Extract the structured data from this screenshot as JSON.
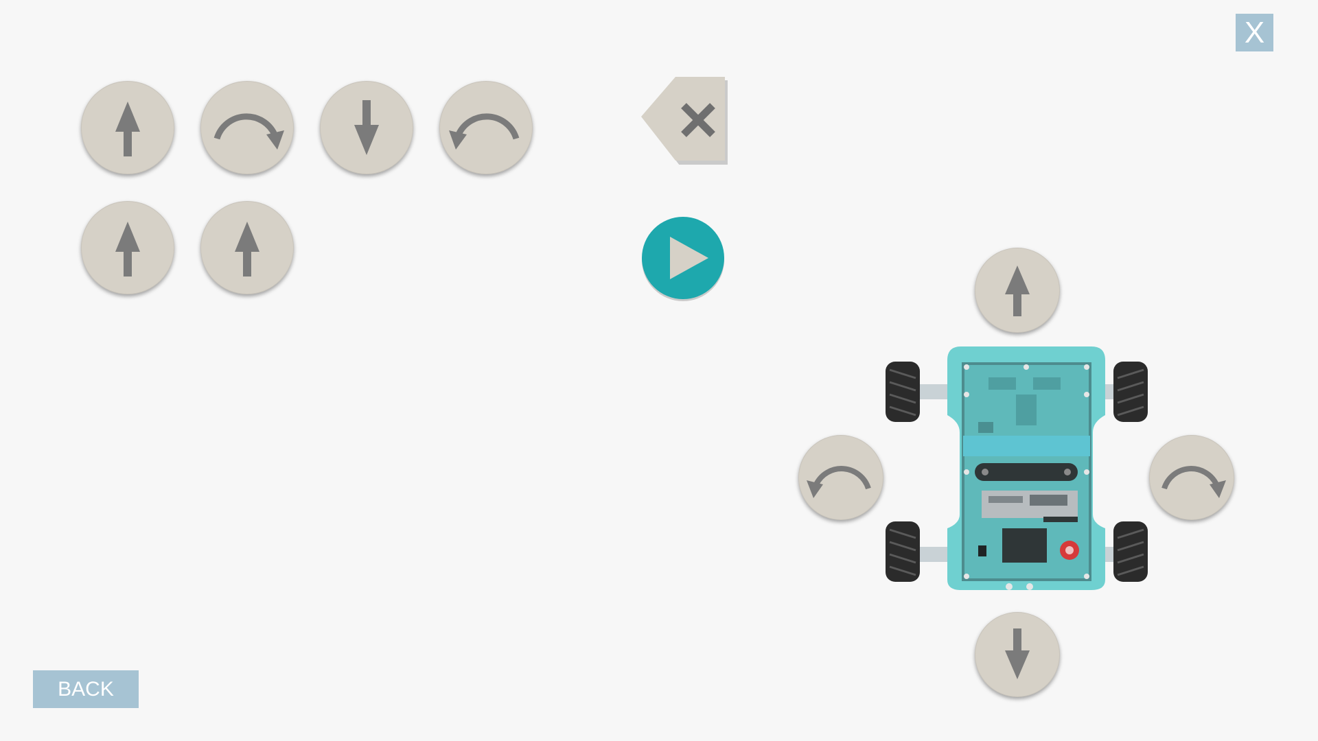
{
  "window": {
    "close_label": "X"
  },
  "footer": {
    "back_label": "BACK"
  },
  "program": {
    "commands": [
      {
        "action": "forward",
        "icon": "arrow-up-icon"
      },
      {
        "action": "turn-right",
        "icon": "rotate-right-icon"
      },
      {
        "action": "backward",
        "icon": "arrow-down-icon"
      },
      {
        "action": "turn-left",
        "icon": "rotate-left-icon"
      },
      {
        "action": "forward",
        "icon": "arrow-up-icon"
      },
      {
        "action": "forward",
        "icon": "arrow-up-icon"
      }
    ]
  },
  "controls": {
    "forward_icon": "arrow-up-icon",
    "backward_icon": "arrow-down-icon",
    "turn_left_icon": "rotate-left-icon",
    "turn_right_icon": "rotate-right-icon",
    "delete_icon": "backspace-icon",
    "run_icon": "play-icon"
  },
  "colors": {
    "button_face": "#d6d1c7",
    "icon": "#7b7b7b",
    "accent_play": "#1ea8ad",
    "action_button": "#a6c3d3",
    "robot_body": "#6fd0d0",
    "background": "#f7f7f7"
  }
}
